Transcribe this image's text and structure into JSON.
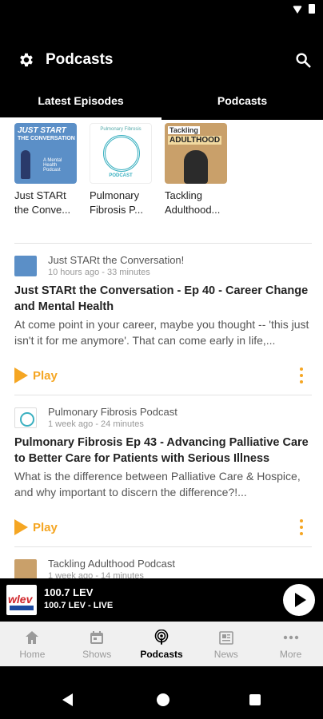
{
  "app": {
    "title": "Podcasts"
  },
  "tabs": [
    {
      "label": "Latest Episodes",
      "active": true
    },
    {
      "label": "Podcasts",
      "active": false
    }
  ],
  "shows": [
    {
      "name": "Just STARt the Conve...",
      "art_title": "JUST START",
      "art_sub": "THE CONVERSATION",
      "art_note": "A Mental Health Podcast"
    },
    {
      "name": "Pulmonary Fibrosis P...",
      "art_title": "Pulmonary Fibrosis",
      "art_sub": "PODCAST"
    },
    {
      "name": "Tackling Adulthood...",
      "art_title": "Tackling",
      "art_sub": "ADULTHOOD"
    }
  ],
  "episodes": [
    {
      "show": "Just STARt the Conversation!",
      "meta": "10 hours ago - 33 minutes",
      "title": "Just STARt the Conversation - Ep 40 - Career Change and Mental Health",
      "description": "At come point in your career, maybe you thought -- 'this just isn't it for me anymore'. That can come early in life,...",
      "play_label": "Play"
    },
    {
      "show": "Pulmonary Fibrosis Podcast",
      "meta": "1 week ago - 24 minutes",
      "title": "Pulmonary Fibrosis Ep 43 - Advancing Palliative Care to Better Care for Patients with Serious Illness",
      "description": "What is the difference between Palliative Care & Hospice, and why important to discern the difference?!...",
      "play_label": "Play"
    },
    {
      "show": "Tackling Adulthood Podcast",
      "meta": "1 week ago - 14 minutes"
    }
  ],
  "player": {
    "station_logo_text": "wlev",
    "station": "100.7 LEV",
    "subtitle": "100.7 LEV - LIVE"
  },
  "nav": [
    {
      "label": "Home",
      "icon": "home-icon",
      "active": false
    },
    {
      "label": "Shows",
      "icon": "calendar-icon",
      "active": false
    },
    {
      "label": "Podcasts",
      "icon": "podcast-icon",
      "active": true
    },
    {
      "label": "News",
      "icon": "newspaper-icon",
      "active": false
    },
    {
      "label": "More",
      "icon": "more-icon",
      "active": false
    }
  ],
  "colors": {
    "accent": "#f5a623",
    "header_bg": "#000000"
  }
}
